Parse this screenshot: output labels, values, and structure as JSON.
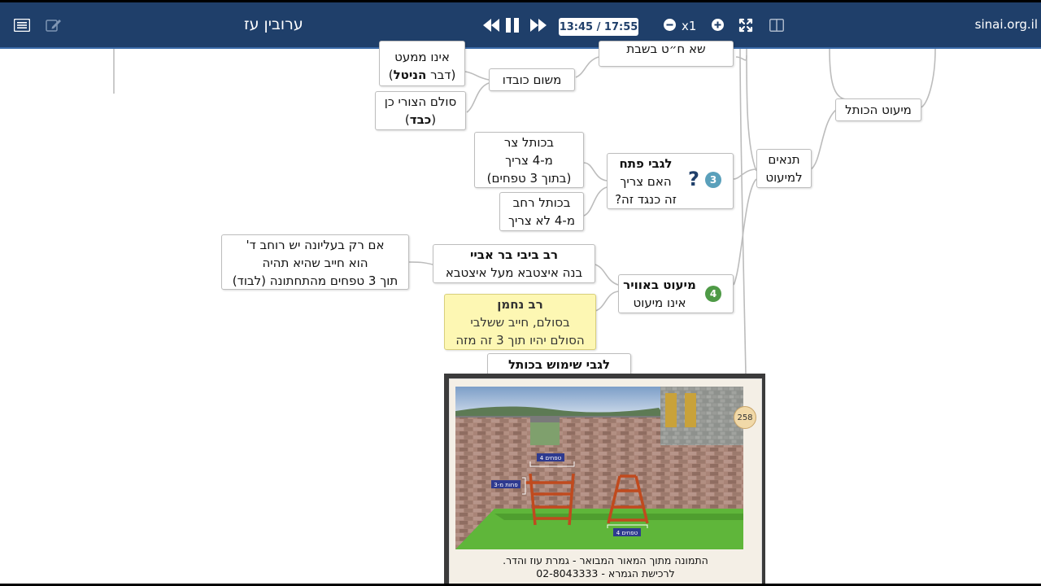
{
  "toolbar": {
    "title": "ערובין עז",
    "time": "13:45 / 17:55",
    "speed": "x1",
    "site": "sinai.org.il",
    "icons": [
      "list-icon",
      "edit-icon",
      "rewind-icon",
      "pause-icon",
      "fast-forward-icon",
      "zoom-out-icon",
      "zoom-in-icon",
      "fullscreen-icon",
      "split-view-icon"
    ]
  },
  "mindmap": {
    "top_partial": "שא ח״ט בשבת",
    "top_partial_left_a": "אינו ממעט",
    "top_partial_left_b": "(דבר ",
    "top_partial_left_b_bold": "הניטל",
    "top_partial_left_b_end": ")",
    "mishum_kavod": "משום כובדו",
    "sulam_tzuri": "סולם הצורי כן",
    "kaved_open": "(",
    "kaved": "כבד",
    "kaved_close": ")",
    "miut_hakotel": "מיעוט הכותל",
    "tnaim_line1": "תנאים",
    "tnaim_line2": "למיעוט",
    "petach_title": "לגבי פתח",
    "petach_line2": "האם צריך",
    "petach_line3": "זה כנגד זה?",
    "badge3": "3",
    "qmark": "?",
    "tzar_line1": "בכותל צר",
    "tzar_line2": "מ-4 צריך",
    "tzar_line3": "(בתוך 3 טפחים)",
    "rachav_line1": "בכותל רחב",
    "rachav_line2": "מ-4 לא צריך",
    "avir_title": "מיעוט באוויר",
    "avir_line2": "אינו מיעוט",
    "badge4": "4",
    "bibi_title": "רב ביבי בר אביי",
    "bibi_line2": "בנה איצטבא מעל איצטבא",
    "aliyona_line1": "אם רק בעליונה יש רוחב ד'",
    "aliyona_line2": "הוא חייב שהיא תהיה",
    "aliyona_line3": "תוך 3 טפחים מהתחתונה (לבוד)",
    "nachman_title": "רב נחמן",
    "nachman_line2": "בסולם, חייב ששלבי",
    "nachman_line3": "הסולם יהיו תוך 3 זה מזה",
    "shimush": "לגבי שימוש בכותל"
  },
  "photo": {
    "page_badge": "258",
    "label_top": "4 טפחים",
    "label_left": "פחות מ-3",
    "label_bottom": "4 טפחים",
    "caption_line1": "התמונה מתוך המאור המבואר - גמרת עוז והדר.",
    "caption_line2": "לרכישת הגמרא - 02-8043333"
  },
  "colors": {
    "toolbar": "#1f3f6a",
    "badge3": "#5aa0bb",
    "badge4": "#4e9a46",
    "yellow_node": "#fdf7b3",
    "qmark": "#1f3f6a"
  }
}
